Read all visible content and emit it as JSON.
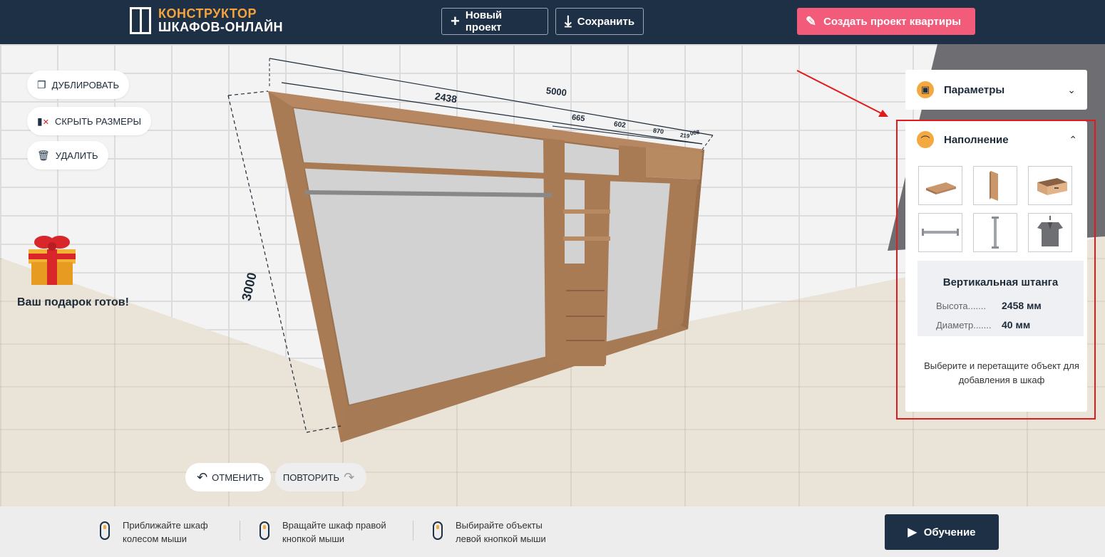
{
  "header": {
    "logo_line1": "КОНСТРУКТОР",
    "logo_line2": "ШКАФОВ-ОНЛАЙН",
    "new_project": "Новый проект",
    "save": "Сохранить",
    "apartment_project": "Создать проект квартиры"
  },
  "tools": {
    "duplicate": "ДУБЛИРОВАТЬ",
    "hide_sizes": "СКРЫТЬ РАЗМЕРЫ",
    "delete": "УДАЛИТЬ"
  },
  "gift": {
    "text": "Ваш подарок готов!"
  },
  "history": {
    "undo": "ОТМЕНИТЬ",
    "redo": "ПОВТОРИТЬ"
  },
  "dimensions": {
    "total_width": "5000",
    "section_width": "2438",
    "height": "3000",
    "seg1": "665",
    "seg2": "602",
    "seg3": "870",
    "seg4": "219",
    "seg5": "008"
  },
  "panel": {
    "params_title": "Параметры",
    "fill_title": "Наполнение",
    "items": [
      "shelf",
      "vertical-divider",
      "drawer",
      "horizontal-rod",
      "vertical-rod",
      "hanger-clothes"
    ],
    "selected": {
      "title": "Вертикальная штанга",
      "height_label": "Высота.......",
      "height_value": "2458 мм",
      "diameter_label": "Диаметр.......",
      "diameter_value": "40 мм"
    },
    "hint": "Выберите и перетащите объект для добавления в шкаф"
  },
  "bottom": {
    "hint1_line1": "Приближайте шкаф",
    "hint1_line2": "колесом мыши",
    "hint2_line1": "Вращайте шкаф правой",
    "hint2_line2": "кнопкой мыши",
    "hint3_line1": "Выбирайте объекты",
    "hint3_line2": "левой кнопкой мыши",
    "learn": "Обучение"
  },
  "colors": {
    "header": "#1d3046",
    "accent": "#f4a940",
    "flat_button": "#f25c7a",
    "highlight": "#e01b1b",
    "rod": "#77e05a"
  }
}
